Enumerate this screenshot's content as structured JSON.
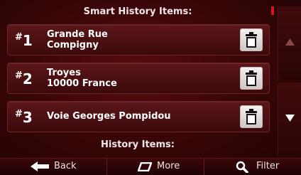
{
  "headers": {
    "smart": "Smart History Items:",
    "history": "History Items:"
  },
  "items": [
    {
      "hash": "#",
      "rank": "1",
      "line1": "Grande Rue",
      "line2": "Compigny"
    },
    {
      "hash": "#",
      "rank": "2",
      "line1": "Troyes",
      "line2": "10000 France"
    },
    {
      "hash": "#",
      "rank": "3",
      "line1": "Voie Georges Pompidou",
      "line2": ""
    }
  ],
  "toolbar": {
    "back_label": "Back",
    "more_label": "More",
    "filter_label": "Filter"
  },
  "icons": {
    "delete": "trash-icon",
    "up": "arrow-up-icon",
    "down": "arrow-down-icon",
    "back": "arrow-left-icon",
    "more": "more-icon",
    "filter": "search-icon"
  },
  "colors": {
    "background": "#3a0607",
    "scroll_indicator": "#d8151c",
    "text": "#ffffff"
  }
}
